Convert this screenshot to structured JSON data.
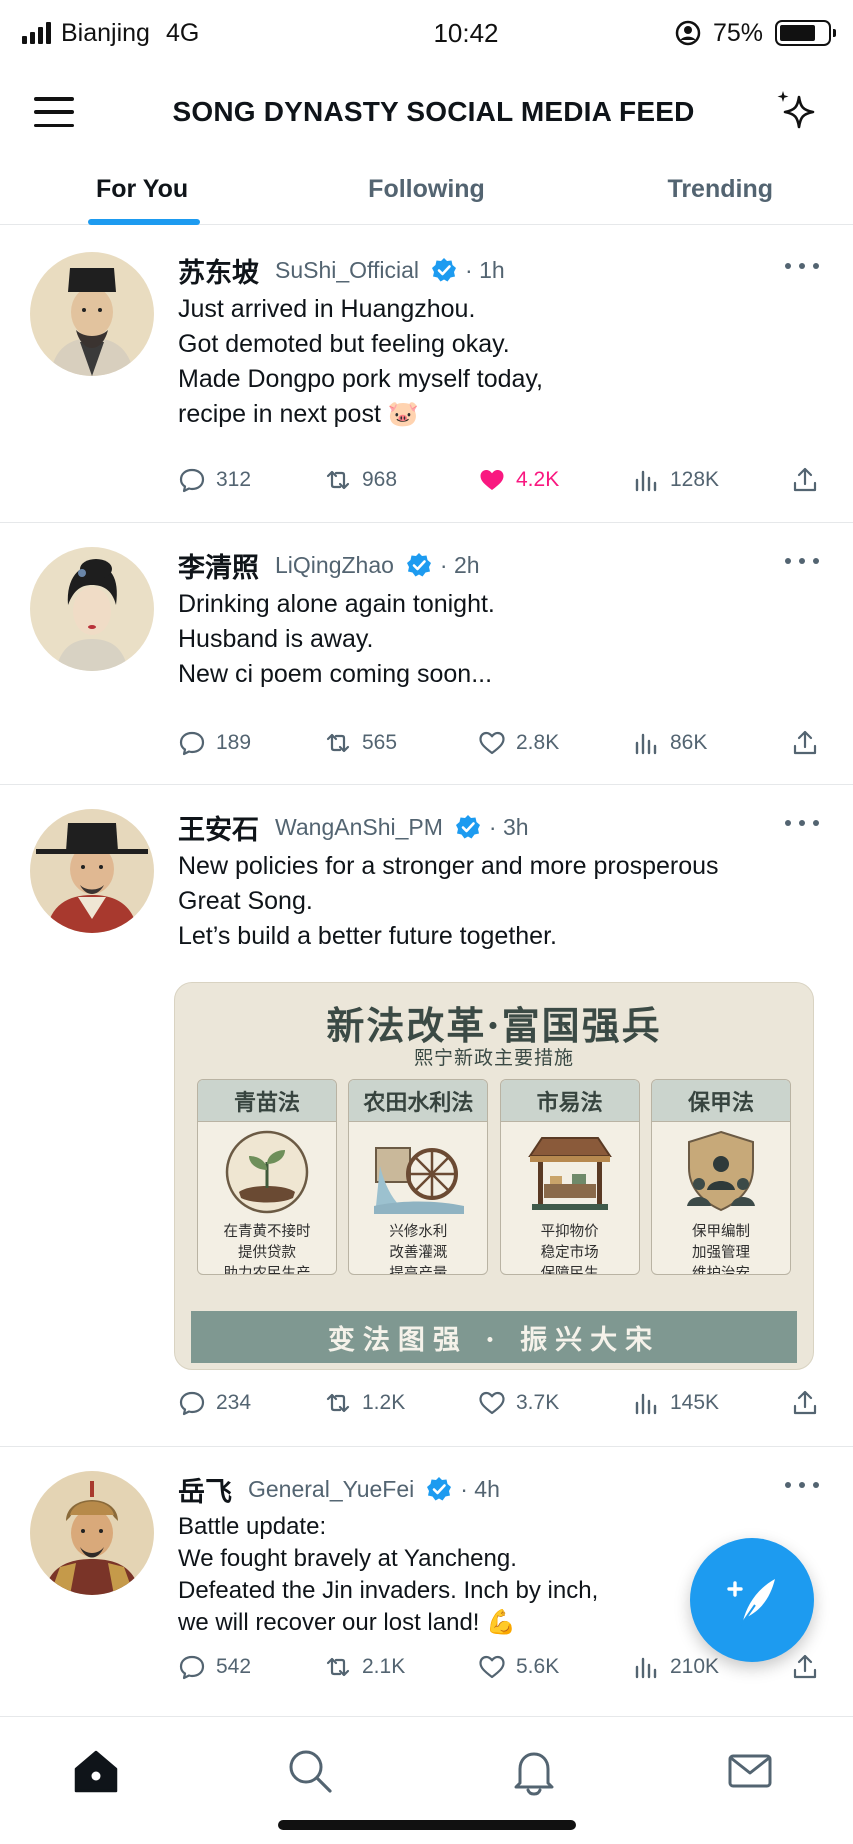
{
  "status_bar": {
    "carrier": "Bianjing",
    "network": "4G",
    "time": "10:42",
    "battery_text": "75%",
    "battery_level": 0.75
  },
  "header": {
    "title": "SONG DYNASTY SOCIAL MEDIA FEED",
    "menu_icon": "hamburger-menu-icon",
    "right_icon": "sparkle-icon"
  },
  "tabs": [
    {
      "label": "For You",
      "active": true
    },
    {
      "label": "Following",
      "active": false
    },
    {
      "label": "Trending",
      "active": false
    }
  ],
  "colors": {
    "accent": "#1d9bf0",
    "like": "#f91880",
    "muted_text": "#536471",
    "text": "#0f1419"
  },
  "posts": [
    {
      "name": "苏东坡",
      "handle": "SuShi_Official",
      "time": "· 1h",
      "verified": true,
      "lines": [
        "Just arrived in Huangzhou.",
        "Got demoted but feeling okay.",
        "Made Dongpo pork myself today,",
        "recipe in next post 🐷"
      ],
      "replies": "312",
      "retweets": "968",
      "likes": "4.2K",
      "liked": true,
      "views": "128K"
    },
    {
      "name": "李清照",
      "handle": "LiQingZhao",
      "time": "· 2h",
      "verified": true,
      "lines": [
        "Drinking alone again tonight.",
        "Husband is away.",
        "New ci poem coming soon..."
      ],
      "replies": "189",
      "retweets": "565",
      "likes": "2.8K",
      "liked": false,
      "views": "86K"
    },
    {
      "name": "王安石",
      "handle": "WangAnShi_PM",
      "time": "· 3h",
      "verified": true,
      "lines": [
        "New policies for a stronger and more prosperous",
        "Great Song.",
        "Let’s build a better future together."
      ],
      "image": {
        "title": "新法改革·富国强兵",
        "subtitle": "熙宁新政主要措施",
        "cards": [
          {
            "title": "青苗法",
            "icon": "seedling-icon",
            "lines": [
              "在青黄不接时",
              "提供贷款",
              "助力农民生产"
            ]
          },
          {
            "title": "农田水利法",
            "icon": "waterwheel-icon",
            "lines": [
              "兴修水利",
              "改善灌溉",
              "提高产量"
            ]
          },
          {
            "title": "市易法",
            "icon": "market-stall-icon",
            "lines": [
              "平抑物价",
              "稳定市场",
              "保障民生"
            ]
          },
          {
            "title": "保甲法",
            "icon": "shield-people-icon",
            "lines": [
              "保甲编制",
              "加强管理",
              "维护治安"
            ]
          }
        ],
        "banner": "变法图强 · 振兴大宋"
      },
      "replies": "234",
      "retweets": "1.2K",
      "likes": "3.7K",
      "liked": false,
      "views": "145K"
    },
    {
      "name": "岳飞",
      "handle": "General_YueFei",
      "time": "· 4h",
      "verified": true,
      "lines": [
        "Battle update:",
        "We fought bravely at Yancheng.",
        "Defeated the Jin invaders. Inch by inch,",
        "we will recover our lost land! 💪"
      ],
      "replies": "542",
      "retweets": "2.1K",
      "likes": "5.6K",
      "liked": false,
      "views": "210K"
    }
  ],
  "fab": {
    "icon": "compose-quill-icon"
  },
  "bottom_nav": [
    {
      "icon": "home-icon",
      "active": true
    },
    {
      "icon": "search-icon",
      "active": false
    },
    {
      "icon": "bell-icon",
      "active": false
    },
    {
      "icon": "mail-icon",
      "active": false
    }
  ]
}
